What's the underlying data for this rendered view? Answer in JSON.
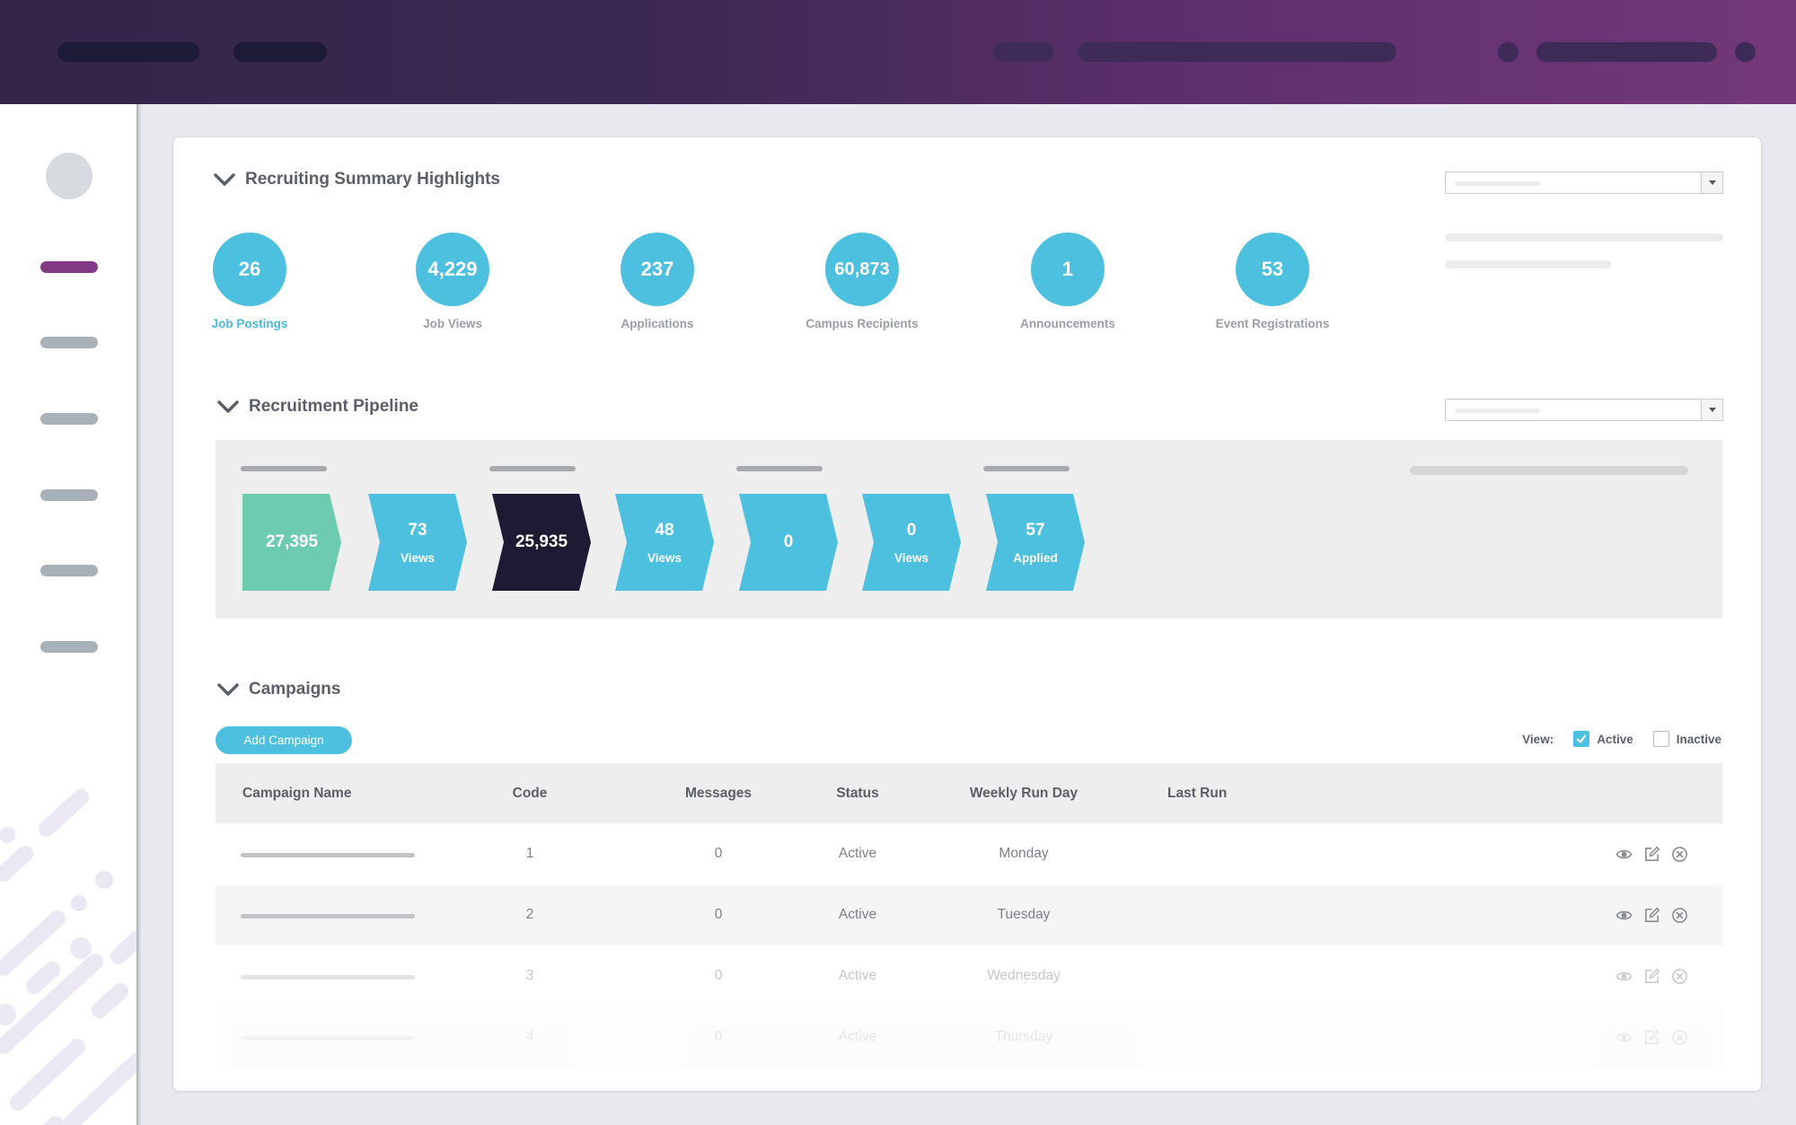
{
  "header": {
    "left_placeholders": 2,
    "right_placeholders": 4
  },
  "sidebar": {
    "items": [
      {
        "name": "nav-item-1",
        "active": true
      },
      {
        "name": "nav-item-2",
        "active": false
      },
      {
        "name": "nav-item-3",
        "active": false
      },
      {
        "name": "nav-item-4",
        "active": false
      },
      {
        "name": "nav-item-5",
        "active": false
      },
      {
        "name": "nav-item-6",
        "active": false
      }
    ]
  },
  "summary": {
    "title": "Recruiting Summary Highlights",
    "stats": [
      {
        "value": "26",
        "label": "Job Postings",
        "active": true
      },
      {
        "value": "4,229",
        "label": "Job Views",
        "active": false
      },
      {
        "value": "237",
        "label": "Applications",
        "active": false
      },
      {
        "value": "60,873",
        "label": "Campus Recipients",
        "active": false
      },
      {
        "value": "1",
        "label": "Announcements",
        "active": false
      },
      {
        "value": "53",
        "label": "Event Registrations",
        "active": false
      }
    ]
  },
  "pipeline": {
    "title": "Recruitment Pipeline",
    "stages": [
      {
        "value": "27,395",
        "sub": "",
        "color": "#6dcbb0",
        "first": true
      },
      {
        "value": "73",
        "sub": "Views",
        "color": "#4ec0df"
      },
      {
        "value": "25,935",
        "sub": "",
        "color": "#1e1a33"
      },
      {
        "value": "48",
        "sub": "Views",
        "color": "#4ec0df"
      },
      {
        "value": "0",
        "sub": "",
        "color": "#4ec0df"
      },
      {
        "value": "0",
        "sub": "Views",
        "color": "#4ec0df"
      },
      {
        "value": "57",
        "sub": "Applied",
        "color": "#4ec0df"
      }
    ]
  },
  "campaigns": {
    "title": "Campaigns",
    "add_button": "Add Campaign",
    "view_label": "View:",
    "filters": [
      {
        "label": "Active",
        "checked": true
      },
      {
        "label": "Inactive",
        "checked": false
      }
    ],
    "columns": [
      "Campaign Name",
      "Code",
      "Messages",
      "Status",
      "Weekly Run Day",
      "Last Run"
    ],
    "rows": [
      {
        "code": "1",
        "messages": "0",
        "status": "Active",
        "day": "Monday",
        "last_run": ""
      },
      {
        "code": "2",
        "messages": "0",
        "status": "Active",
        "day": "Tuesday",
        "last_run": ""
      },
      {
        "code": "3",
        "messages": "0",
        "status": "Active",
        "day": "Wednesday",
        "last_run": ""
      },
      {
        "code": "4",
        "messages": "0",
        "status": "Active",
        "day": "Thursday",
        "last_run": ""
      }
    ],
    "row_actions": [
      "view-icon",
      "edit-icon",
      "delete-icon"
    ]
  },
  "colors": {
    "accent": "#4ec0df",
    "brand_purple": "#823a86",
    "pipeline_green": "#6dcbb0",
    "pipeline_dark": "#1e1a33"
  }
}
